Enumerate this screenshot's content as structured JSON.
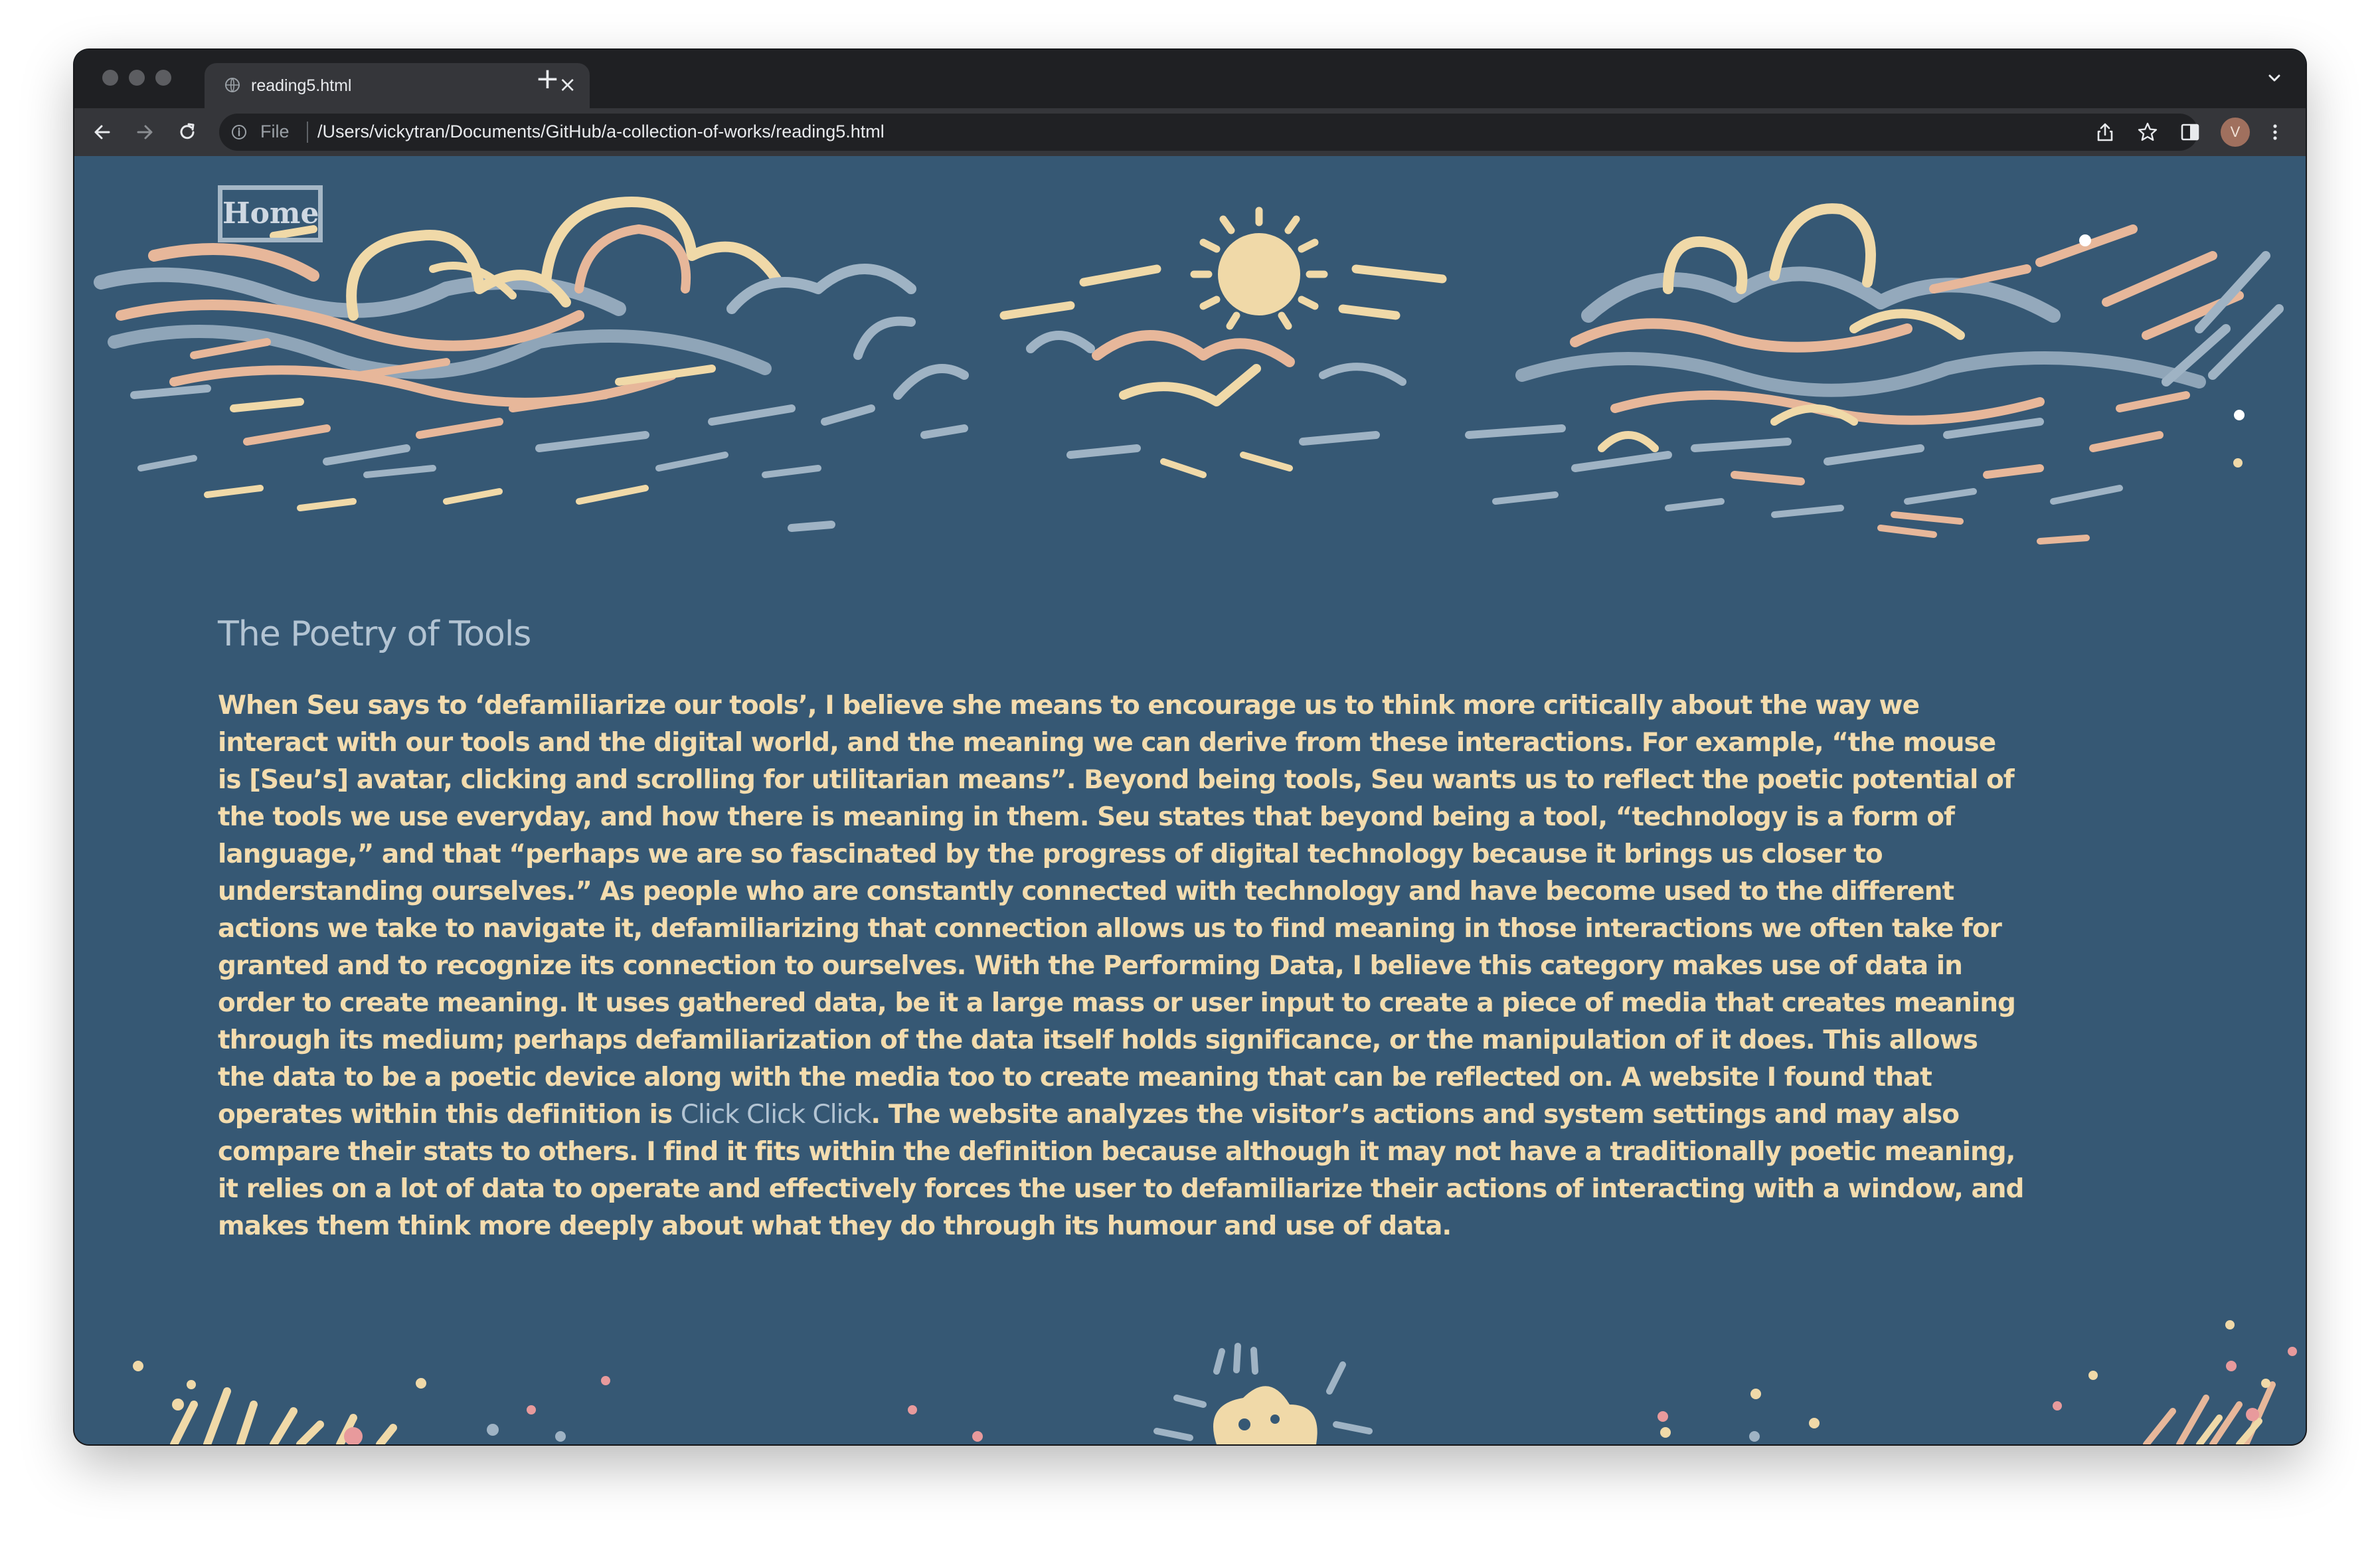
{
  "browser": {
    "tab_title": "reading5.html",
    "tab_close": "×",
    "new_tab": "+",
    "url_scheme_label": "File",
    "url": "/Users/vickytran/Documents/GitHub/a-collection-of-works/reading5.html",
    "profile_initial": "V"
  },
  "page": {
    "home_label": "Home",
    "title": "The Poetry of Tools",
    "paragraph_before_link": "When Seu says to ‘defamiliarize our tools’, I believe she means to encourage us to think more critically about the way we interact with our tools and the digital world, and the meaning we can derive from these interactions. For example, “the mouse is [Seu’s] avatar, clicking and scrolling for utilitarian means”. Beyond being tools, Seu wants us to reflect the poetic potential of the tools we use everyday, and how there is meaning in them. Seu states that beyond being a tool, “technology is a form of language,” and that “perhaps we are so fascinated by the progress of digital technology because it brings us closer to understanding ourselves.” As people who are constantly connected with technology and have become used to the different actions we take to navigate it, defamiliarizing that connection allows us to find meaning in those interactions we often take for granted and to recognize its connection to ourselves. With the Performing Data, I believe this category makes use of data in order to create meaning. It uses gathered data, be it a large mass or user input to create a piece of media that creates meaning through its medium; perhaps defamiliarization of the data itself holds significance, or the manipulation of it does. This allows the data to be a poetic device along with the media too to create meaning that can be reflected on. A website I found that operates within this definition is ",
    "link_text": "Click Click Click",
    "paragraph_after_link": ". The website analyzes the visitor’s actions and system settings and may also compare their stats to others. I find it fits within the definition because although it may not have a traditionally poetic meaning, it relies on a lot of data to operate and effectively forces the user to defamiliarize their actions of interacting with a window, and makes them think more deeply about what they do through its humour and use of data."
  },
  "colors": {
    "page_background": "#365874",
    "body_text": "#f3dcae",
    "heading_and_link": "#b3c4d3",
    "deco_cream": "#f0d9a8",
    "deco_peach": "#e7b79a",
    "deco_blue_gray": "#9fb3c4",
    "deco_pink": "#e89a9c"
  }
}
